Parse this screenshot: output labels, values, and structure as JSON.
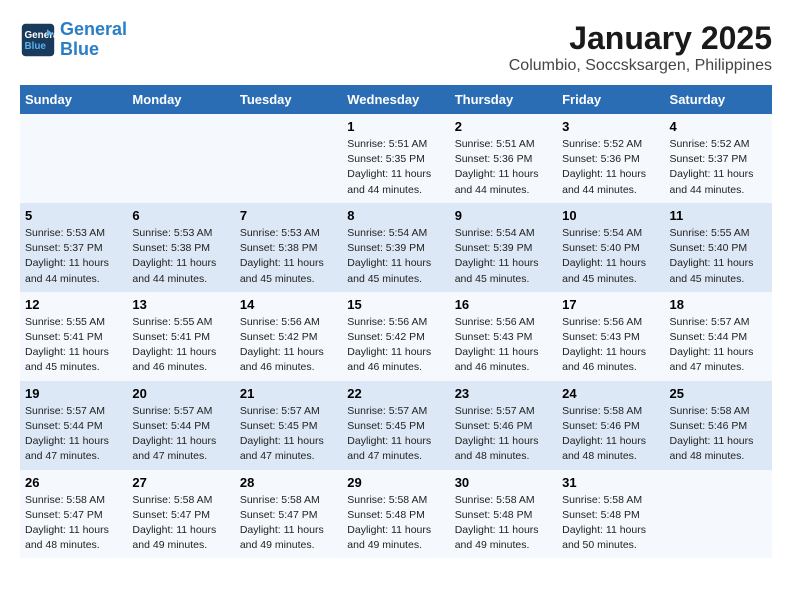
{
  "logo": {
    "line1": "General",
    "line2": "Blue"
  },
  "title": "January 2025",
  "subtitle": "Columbio, Soccsksargen, Philippines",
  "days_of_week": [
    "Sunday",
    "Monday",
    "Tuesday",
    "Wednesday",
    "Thursday",
    "Friday",
    "Saturday"
  ],
  "weeks": [
    [
      {
        "day": "",
        "info": ""
      },
      {
        "day": "",
        "info": ""
      },
      {
        "day": "",
        "info": ""
      },
      {
        "day": "1",
        "info": "Sunrise: 5:51 AM\nSunset: 5:35 PM\nDaylight: 11 hours and 44 minutes."
      },
      {
        "day": "2",
        "info": "Sunrise: 5:51 AM\nSunset: 5:36 PM\nDaylight: 11 hours and 44 minutes."
      },
      {
        "day": "3",
        "info": "Sunrise: 5:52 AM\nSunset: 5:36 PM\nDaylight: 11 hours and 44 minutes."
      },
      {
        "day": "4",
        "info": "Sunrise: 5:52 AM\nSunset: 5:37 PM\nDaylight: 11 hours and 44 minutes."
      }
    ],
    [
      {
        "day": "5",
        "info": "Sunrise: 5:53 AM\nSunset: 5:37 PM\nDaylight: 11 hours and 44 minutes."
      },
      {
        "day": "6",
        "info": "Sunrise: 5:53 AM\nSunset: 5:38 PM\nDaylight: 11 hours and 44 minutes."
      },
      {
        "day": "7",
        "info": "Sunrise: 5:53 AM\nSunset: 5:38 PM\nDaylight: 11 hours and 45 minutes."
      },
      {
        "day": "8",
        "info": "Sunrise: 5:54 AM\nSunset: 5:39 PM\nDaylight: 11 hours and 45 minutes."
      },
      {
        "day": "9",
        "info": "Sunrise: 5:54 AM\nSunset: 5:39 PM\nDaylight: 11 hours and 45 minutes."
      },
      {
        "day": "10",
        "info": "Sunrise: 5:54 AM\nSunset: 5:40 PM\nDaylight: 11 hours and 45 minutes."
      },
      {
        "day": "11",
        "info": "Sunrise: 5:55 AM\nSunset: 5:40 PM\nDaylight: 11 hours and 45 minutes."
      }
    ],
    [
      {
        "day": "12",
        "info": "Sunrise: 5:55 AM\nSunset: 5:41 PM\nDaylight: 11 hours and 45 minutes."
      },
      {
        "day": "13",
        "info": "Sunrise: 5:55 AM\nSunset: 5:41 PM\nDaylight: 11 hours and 46 minutes."
      },
      {
        "day": "14",
        "info": "Sunrise: 5:56 AM\nSunset: 5:42 PM\nDaylight: 11 hours and 46 minutes."
      },
      {
        "day": "15",
        "info": "Sunrise: 5:56 AM\nSunset: 5:42 PM\nDaylight: 11 hours and 46 minutes."
      },
      {
        "day": "16",
        "info": "Sunrise: 5:56 AM\nSunset: 5:43 PM\nDaylight: 11 hours and 46 minutes."
      },
      {
        "day": "17",
        "info": "Sunrise: 5:56 AM\nSunset: 5:43 PM\nDaylight: 11 hours and 46 minutes."
      },
      {
        "day": "18",
        "info": "Sunrise: 5:57 AM\nSunset: 5:44 PM\nDaylight: 11 hours and 47 minutes."
      }
    ],
    [
      {
        "day": "19",
        "info": "Sunrise: 5:57 AM\nSunset: 5:44 PM\nDaylight: 11 hours and 47 minutes."
      },
      {
        "day": "20",
        "info": "Sunrise: 5:57 AM\nSunset: 5:44 PM\nDaylight: 11 hours and 47 minutes."
      },
      {
        "day": "21",
        "info": "Sunrise: 5:57 AM\nSunset: 5:45 PM\nDaylight: 11 hours and 47 minutes."
      },
      {
        "day": "22",
        "info": "Sunrise: 5:57 AM\nSunset: 5:45 PM\nDaylight: 11 hours and 47 minutes."
      },
      {
        "day": "23",
        "info": "Sunrise: 5:57 AM\nSunset: 5:46 PM\nDaylight: 11 hours and 48 minutes."
      },
      {
        "day": "24",
        "info": "Sunrise: 5:58 AM\nSunset: 5:46 PM\nDaylight: 11 hours and 48 minutes."
      },
      {
        "day": "25",
        "info": "Sunrise: 5:58 AM\nSunset: 5:46 PM\nDaylight: 11 hours and 48 minutes."
      }
    ],
    [
      {
        "day": "26",
        "info": "Sunrise: 5:58 AM\nSunset: 5:47 PM\nDaylight: 11 hours and 48 minutes."
      },
      {
        "day": "27",
        "info": "Sunrise: 5:58 AM\nSunset: 5:47 PM\nDaylight: 11 hours and 49 minutes."
      },
      {
        "day": "28",
        "info": "Sunrise: 5:58 AM\nSunset: 5:47 PM\nDaylight: 11 hours and 49 minutes."
      },
      {
        "day": "29",
        "info": "Sunrise: 5:58 AM\nSunset: 5:48 PM\nDaylight: 11 hours and 49 minutes."
      },
      {
        "day": "30",
        "info": "Sunrise: 5:58 AM\nSunset: 5:48 PM\nDaylight: 11 hours and 49 minutes."
      },
      {
        "day": "31",
        "info": "Sunrise: 5:58 AM\nSunset: 5:48 PM\nDaylight: 11 hours and 50 minutes."
      },
      {
        "day": "",
        "info": ""
      }
    ]
  ]
}
